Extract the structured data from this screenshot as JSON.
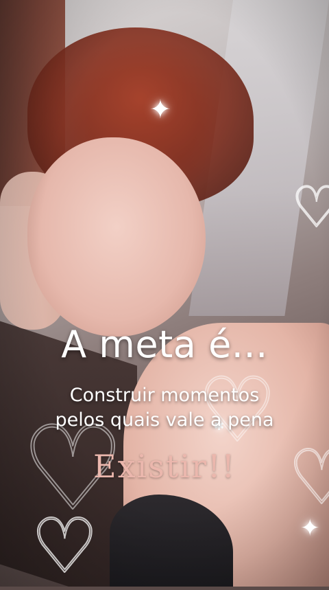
{
  "video": {
    "caption_title": "A meta é...",
    "caption_line1": "Construir momentos",
    "caption_line2": "pelos quais vale a pena",
    "caption_final": "Existir!!",
    "accent_color": "#ebb7ad"
  },
  "decorations": {
    "sparkle_glyph": "✦",
    "heart_glyph": "♡",
    "small_sparkle_glyph": "✱"
  }
}
